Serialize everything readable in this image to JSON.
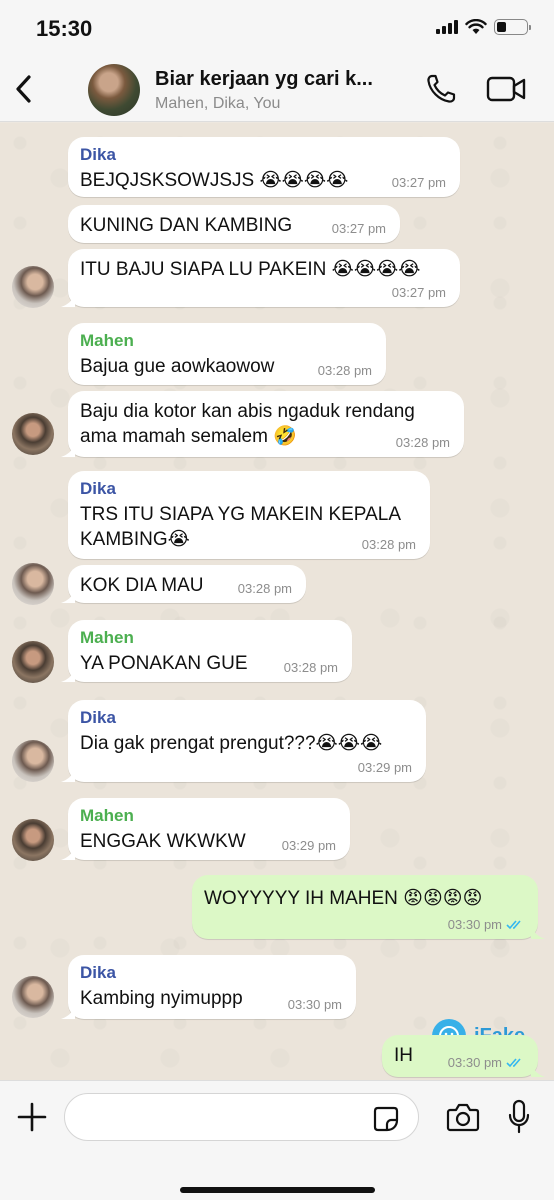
{
  "status_bar": {
    "time": "15:30"
  },
  "header": {
    "title": "Biar kerjaan yg cari k...",
    "members": "Mahen, Dika, You"
  },
  "messages": [
    {
      "sender": "Dika",
      "text": "BEJQJSKSOWJSJS 😭😭😭😭",
      "time": "03:27 pm"
    },
    {
      "sender": "",
      "text": "KUNING DAN KAMBING",
      "time": "03:27 pm"
    },
    {
      "sender": "",
      "text": "ITU BAJU SIAPA LU PAKEIN 😭😭😭😭",
      "time": "03:27 pm"
    },
    {
      "sender": "Mahen",
      "text": "Bajua gue aowkaowow",
      "time": "03:28 pm"
    },
    {
      "sender": "",
      "text": "Baju dia kotor kan abis ngaduk rendang\nama mamah semalem 🤣",
      "time": "03:28 pm"
    },
    {
      "sender": "Dika",
      "text": "TRS ITU SIAPA YG MAKEIN KEPALA\nKAMBING😭",
      "time": "03:28 pm"
    },
    {
      "sender": "",
      "text": "KOK DIA MAU",
      "time": "03:28 pm"
    },
    {
      "sender": "Mahen",
      "text": "YA PONAKAN GUE",
      "time": "03:28 pm"
    },
    {
      "sender": "Dika",
      "text": "Dia gak prengat prengut???😭😭😭",
      "time": "03:29 pm"
    },
    {
      "sender": "Mahen",
      "text": "ENGGAK WKWKW",
      "time": "03:29 pm"
    },
    {
      "sender": "You",
      "text": "WOYYYYY IH MAHEN 😡😡😡😡",
      "time": "03:30 pm"
    },
    {
      "sender": "Dika",
      "text": "Kambing nyimuppp",
      "time": "03:30 pm"
    },
    {
      "sender": "You",
      "text": "IH",
      "time": "03:30 pm"
    }
  ],
  "watermark": {
    "text": "iFake"
  },
  "input": {
    "placeholder": "",
    "value": ""
  },
  "colors": {
    "outgoing": "#dcf8c6",
    "incoming": "#ffffff",
    "dika_name": "#3c55a5",
    "mahen_name": "#4caf50",
    "read_ticks": "#34b7f1"
  },
  "icons": [
    "back-arrow-icon",
    "phone-icon",
    "video-camera-icon",
    "plus-icon",
    "sticker-icon",
    "camera-icon",
    "microphone-icon"
  ]
}
